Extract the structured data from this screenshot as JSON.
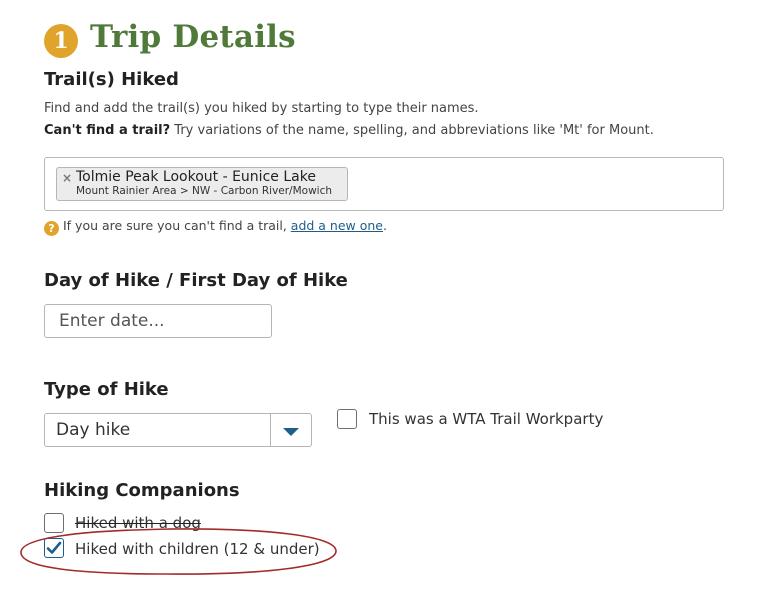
{
  "header": {
    "step_number": "1",
    "title": "Trip Details"
  },
  "trails": {
    "heading": "Trail(s) Hiked",
    "help_line1": "Find and add the trail(s) you hiked by starting to type their names.",
    "help_line2_bold": "Can't find a trail?",
    "help_line2_rest": " Try variations of the name, spelling, and abbreviations like 'Mt' for Mount.",
    "selected": [
      {
        "remove_glyph": "×",
        "name": "Tolmie Peak Lookout - Eunice Lake",
        "region": "Mount Rainier Area > NW - Carbon River/Mowich"
      }
    ],
    "notice_icon": "?",
    "notice_text": "If you are sure you can't find a trail, ",
    "notice_link": "add a new one",
    "notice_end": "."
  },
  "date": {
    "heading": "Day of Hike / First Day of Hike",
    "placeholder": "Enter date..."
  },
  "hike_type": {
    "heading": "Type of Hike",
    "selected_value": "Day hike",
    "workparty_label": "This was a WTA Trail Workparty",
    "workparty_checked": false
  },
  "companions": {
    "heading": "Hiking Companions",
    "dog_label": "Hiked with a dog",
    "dog_checked": false,
    "children_label": "Hiked with children (12 & under)",
    "children_checked": true
  },
  "colors": {
    "accent": "#e0a42c",
    "title_green": "#4f7a3a",
    "check_blue": "#1f5e8a",
    "annotation_red": "#a32b2b"
  }
}
